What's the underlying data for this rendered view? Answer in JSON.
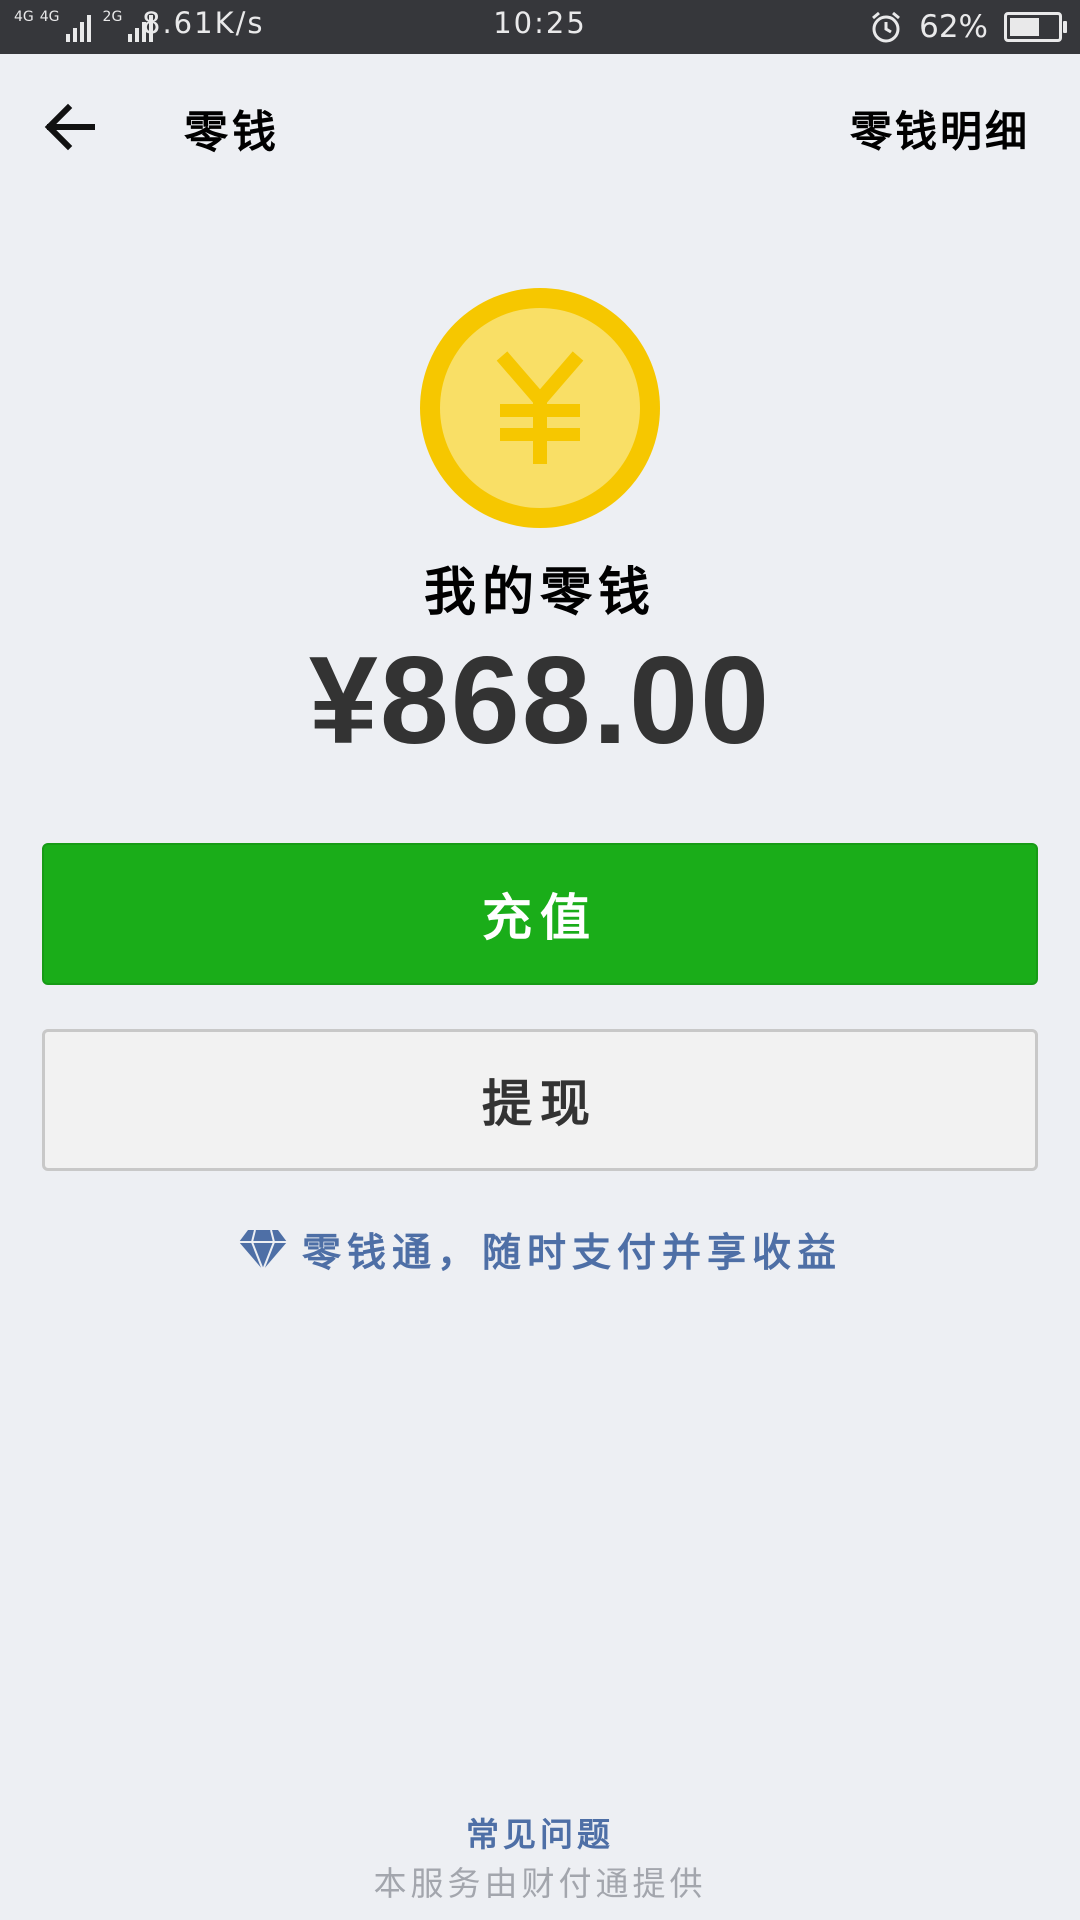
{
  "status_bar": {
    "network_1": "4G",
    "network_2": "4G",
    "network_3": "2G",
    "speed": "8.61K/s",
    "time": "10:25",
    "battery_percent": "62%",
    "battery_level": 0.62
  },
  "nav": {
    "back_icon": "arrow-left-icon",
    "title": "零钱",
    "detail_link": "零钱明细"
  },
  "wallet": {
    "coin_icon": "yuan-coin-icon",
    "label": "我的零钱",
    "balance": "¥868.00"
  },
  "actions": {
    "recharge_label": "充值",
    "withdraw_label": "提现"
  },
  "promo": {
    "icon": "diamond-icon",
    "text": "零钱通，随时支付并享收益"
  },
  "footer": {
    "faq": "常见问题",
    "provider": "本服务由财付通提供"
  },
  "colors": {
    "status_bar": "#36373b",
    "background": "#edeff3",
    "primary_green": "#1aad19",
    "link_blue": "#4e6fa6",
    "coin_outer": "#f6c700",
    "coin_inner": "#f9df66"
  }
}
